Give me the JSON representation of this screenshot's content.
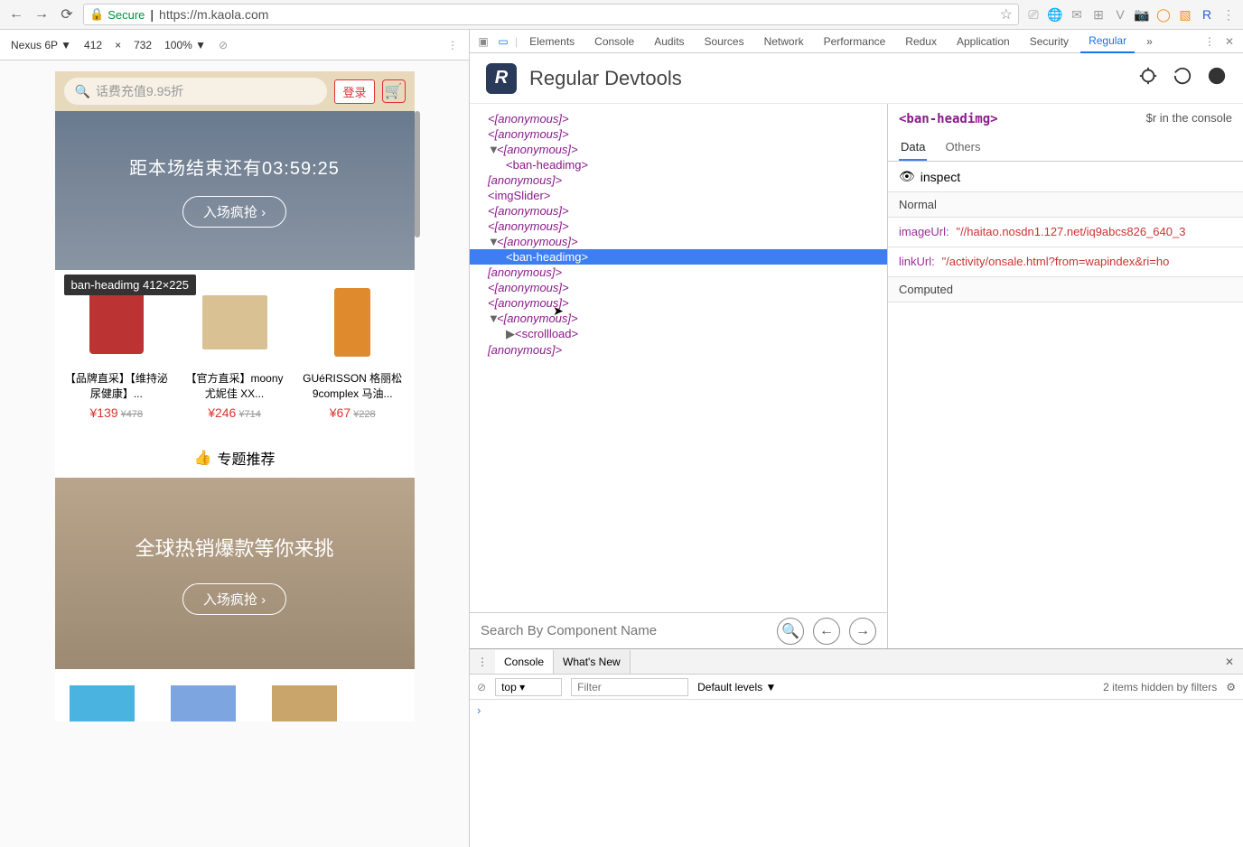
{
  "browser": {
    "secure": "Secure",
    "url": "https://m.kaola.com",
    "star": "☆"
  },
  "deviceBar": {
    "device": "Nexus 6P ▼",
    "width": "412",
    "sep": "×",
    "height": "732",
    "zoom": "100% ▼"
  },
  "mobile": {
    "searchPlaceholder": "话费充值9.95折",
    "login": "登录",
    "banner1Text": "距本场结束还有03:59:25",
    "banner1Btn": "入场疯抢 ›",
    "tooltip": "ban-headimg 412×225",
    "products": [
      {
        "title": "【品牌直采】【维持泌尿健康】...",
        "price": "¥139",
        "old": "¥478"
      },
      {
        "title": "【官方直采】moony 尤妮佳 XX...",
        "price": "¥246",
        "old": "¥714"
      },
      {
        "title": "GUéRISSON 格丽松 9complex 马油...",
        "price": "¥67",
        "old": "¥228"
      }
    ],
    "sectionHead": "专题推荐",
    "banner2Text": "全球热销爆款等你来挑",
    "banner2Btn": "入场疯抢 ›"
  },
  "devtools": {
    "tabs": [
      "Elements",
      "Console",
      "Audits",
      "Sources",
      "Network",
      "Performance",
      "Redux",
      "Application",
      "Security",
      "Regular"
    ],
    "activeTab": "Regular",
    "more": "»"
  },
  "regular": {
    "title": "Regular Devtools",
    "tree": [
      {
        "indent": 0,
        "open": "<",
        "name": "[anonymous]",
        "close": ">"
      },
      {
        "indent": 0,
        "open": "<",
        "name": "[anonymous]",
        "close": ">"
      },
      {
        "indent": 0,
        "arrow": "▼",
        "open": "<",
        "name": "[anonymous]",
        "close": ">"
      },
      {
        "indent": 1,
        "open": "<",
        "name": "ban-headimg",
        "close": ">",
        "tag": true
      },
      {
        "indent": 0,
        "open": "</",
        "name": "[anonymous]",
        "close": ">"
      },
      {
        "indent": 0,
        "open": "<",
        "name": "imgSlider",
        "close": ">",
        "tag": true
      },
      {
        "indent": 0,
        "open": "<",
        "name": "[anonymous]",
        "close": ">"
      },
      {
        "indent": 0,
        "open": "<",
        "name": "[anonymous]",
        "close": ">"
      },
      {
        "indent": 0,
        "arrow": "▼",
        "open": "<",
        "name": "[anonymous]",
        "close": ">"
      },
      {
        "indent": 1,
        "open": "<",
        "name": "ban-headimg",
        "close": ">",
        "tag": true,
        "selected": true
      },
      {
        "indent": 0,
        "open": "</",
        "name": "[anonymous]",
        "close": ">"
      },
      {
        "indent": 0,
        "open": "<",
        "name": "[anonymous]",
        "close": ">"
      },
      {
        "indent": 0,
        "open": "<",
        "name": "[anonymous]",
        "close": ">"
      },
      {
        "indent": 0,
        "arrow": "▼",
        "open": "<",
        "name": "[anonymous]",
        "close": ">"
      },
      {
        "indent": 1,
        "arrow": "▶",
        "open": "<",
        "name": "scrollload",
        "close": ">",
        "tag": true
      },
      {
        "indent": 0,
        "open": "</",
        "name": "[anonymous]",
        "close": ">"
      }
    ],
    "searchPlaceholder": "Search By Component Name"
  },
  "sidePanel": {
    "element": "<ban-headimg>",
    "rInfo": "$r in the console",
    "tabs": [
      "Data",
      "Others"
    ],
    "inspect": "inspect",
    "normalHead": "Normal",
    "data": [
      {
        "key": "imageUrl:",
        "val": "\"//haitao.nosdn1.127.net/iq9abcs826_640_3"
      },
      {
        "key": "linkUrl:",
        "val": "\"/activity/onsale.html?from=wapindex&ri=ho"
      }
    ],
    "computedHead": "Computed"
  },
  "console": {
    "tab1": "Console",
    "tab2": "What's New",
    "context": "top",
    "filterPlaceholder": "Filter",
    "levels": "Default levels ▼",
    "hidden": "2 items hidden by filters",
    "prompt": "›"
  }
}
